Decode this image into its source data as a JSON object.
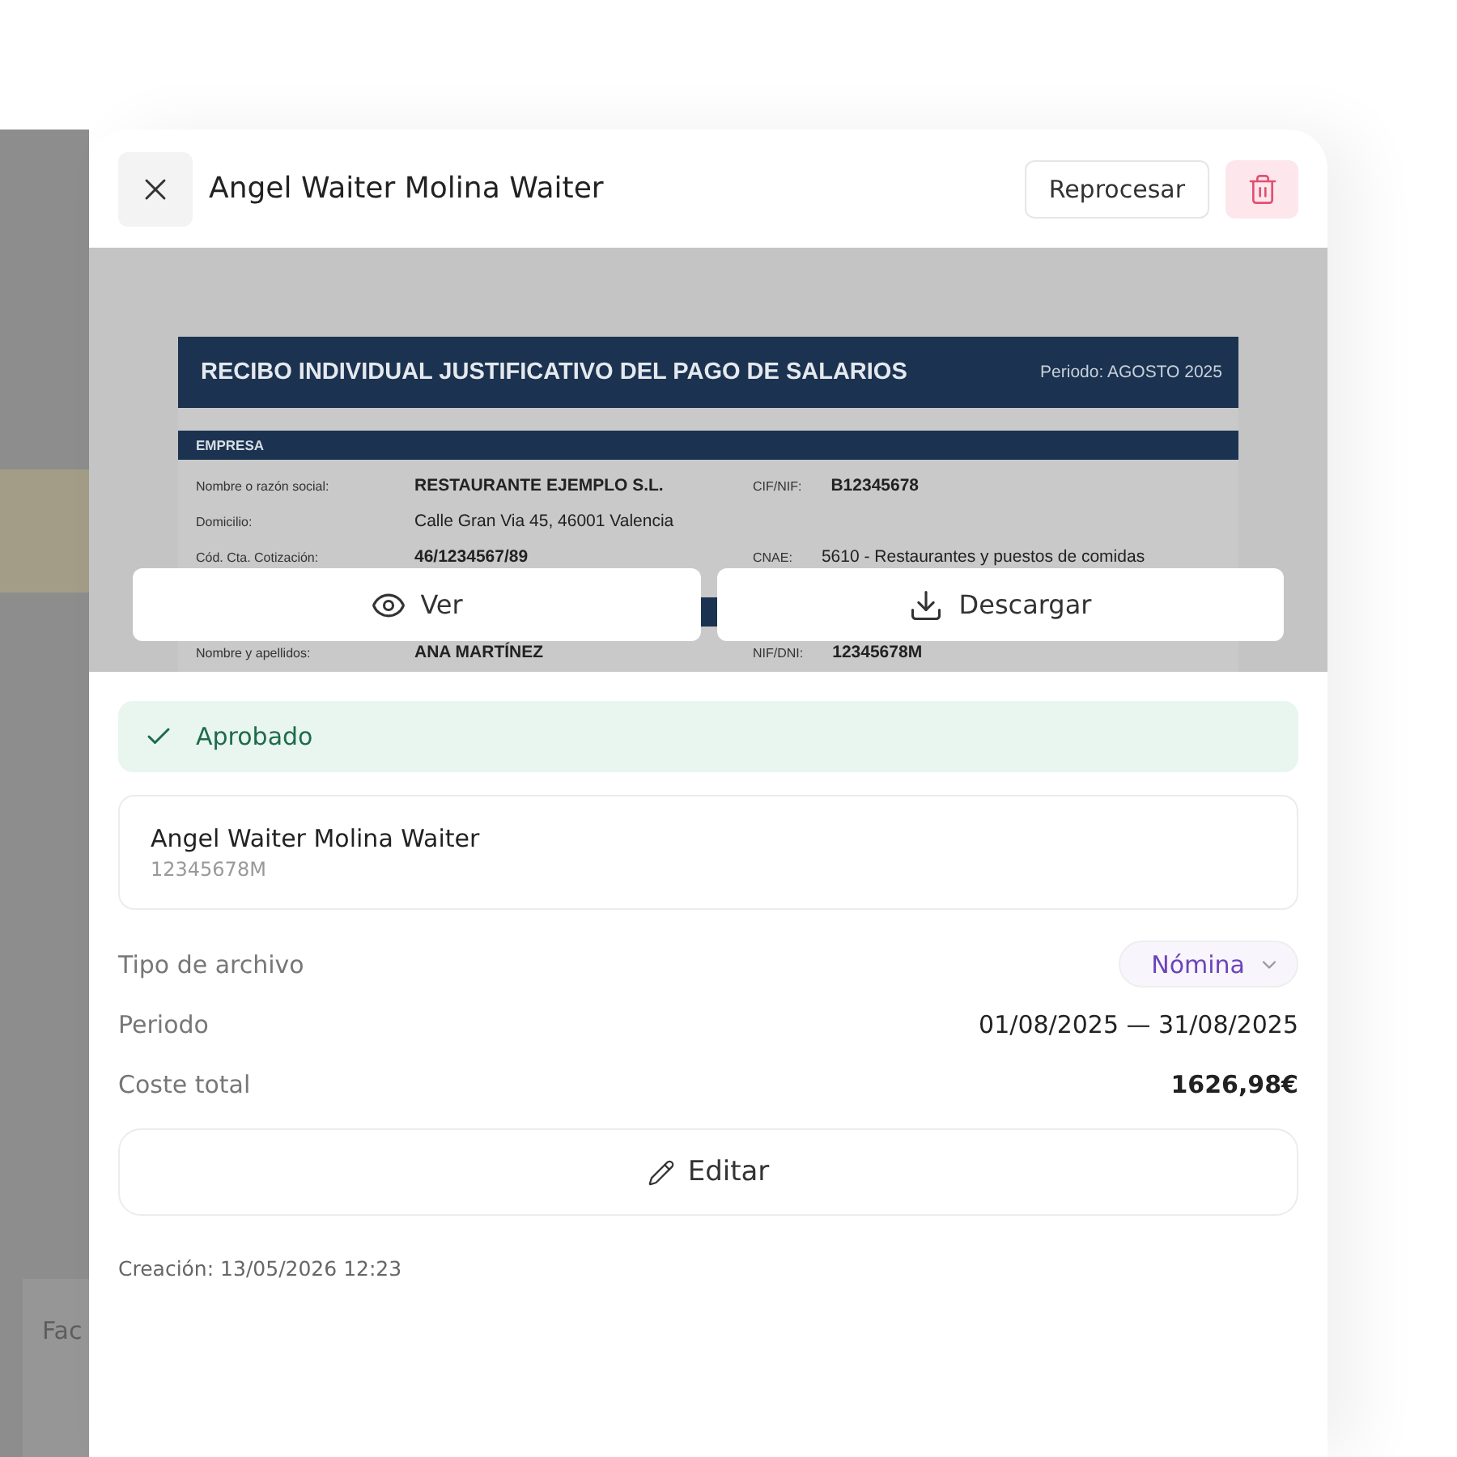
{
  "background": {
    "card_text": "Fac"
  },
  "dialog": {
    "title": "Angel Waiter Molina Waiter",
    "reprocess_button": "Reprocesar"
  },
  "preview": {
    "document": {
      "title": "RECIBO INDIVIDUAL JUSTIFICATIVO DEL PAGO DE SALARIOS",
      "period": "Periodo: AGOSTO 2025",
      "sections": [
        {
          "heading": "EMPRESA",
          "rows": [
            {
              "label": "Nombre o razón social:",
              "value": "RESTAURANTE EJEMPLO S.L.",
              "bold": true,
              "label_2": "CIF/NIF:",
              "value_2": "B12345678",
              "bold_2": true
            },
            {
              "label": "Domicilio:",
              "value": "Calle Gran Via 45, 46001 Valencia",
              "bold": false
            },
            {
              "label": "Cód. Cta. Cotización:",
              "value": "46/1234567/89",
              "bold": true,
              "label_2": "CNAE:",
              "value_2": "5610 - Restaurantes y puestos de comidas",
              "bold_2": false
            }
          ]
        },
        {
          "rows": [
            {
              "label": "Nombre y apellidos:",
              "value": "ANA MARTÍNEZ",
              "bold": true,
              "label_2": "NIF/DNI:",
              "value_2": "12345678M",
              "bold_2": true
            }
          ]
        }
      ]
    },
    "buttons": [
      {
        "kind": "view",
        "label": "Ver"
      },
      {
        "kind": "download",
        "label": "Descargar"
      }
    ]
  },
  "status": {
    "kind": "approved",
    "label": "Aprobado"
  },
  "employee": {
    "name": "Angel Waiter Molina Waiter",
    "id": "12345678M"
  },
  "fields": [
    {
      "kind": "select",
      "label": "Tipo de archivo",
      "value": "Nómina"
    },
    {
      "kind": "text",
      "label": "Periodo",
      "value": "01/08/2025 — 31/08/2025"
    },
    {
      "kind": "total",
      "label": "Coste total",
      "value": "1626,98€"
    }
  ],
  "edit_button": "Editar",
  "created": "Creación: 13/05/2026 12:23"
}
